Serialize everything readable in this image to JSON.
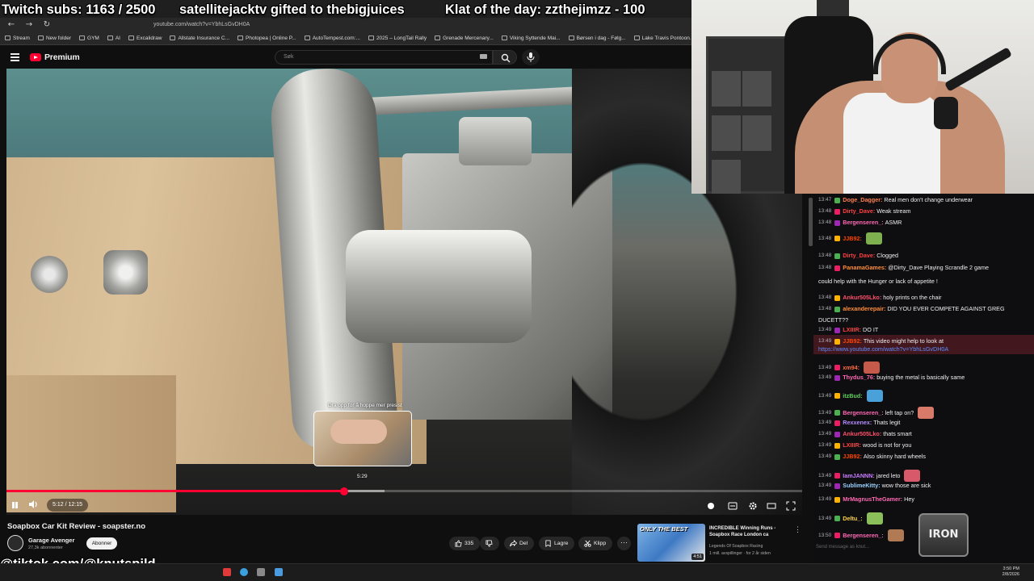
{
  "overlay": {
    "subs": "Twitch subs: 1163 / 2500",
    "gift": "satellitejacktv gifted to thebigjuices",
    "klat": "Klat of the day: zzthejimzz - 100",
    "tiktok": "@tiktok.com/@knutspild"
  },
  "browser": {
    "url": "youtube.com/watch?v=YbhLsGvDH0A",
    "bookmarks": [
      "Stream",
      "New folder",
      "GYM",
      "AI",
      "Excalidraw",
      "Allstate Insurance C...",
      "Photopea | Online P...",
      "AutoTempest.com:...",
      "2025 – LongTail Rally",
      "Grenade Mercenary...",
      "Viking Syttende Mai...",
      "Børsen i dag - Følg...",
      "Lake Travis Pontoon..."
    ]
  },
  "youtube": {
    "logo": "Premium",
    "search_placeholder": "Søk",
    "preview_hint": "Dra opp for å hoppe mer presist",
    "preview_time": "5:29",
    "time": "5:12 / 12:15",
    "progress": 0.4244,
    "loaded": 0.475,
    "title": "Soapbox Car Kit Review - soapster.no",
    "channel": "Garage Avenger",
    "subs": "27,3k abonnenter",
    "subscribe": "Abonner",
    "likes": "335",
    "share": "Del",
    "save": "Lagre",
    "clip": "Klipp",
    "reco": {
      "thumb_text": "ONLY THE BEST",
      "duration": "4:51",
      "title": "INCREDIBLE Winning Runs - Soapbox Race London ca",
      "channel": "Legends Of Soapbox Racing",
      "views": "1 mill. avspillinger · for 2 år siden"
    }
  },
  "chat": {
    "messages": [
      {
        "ts": "13:47",
        "user": "Doge_Dagger:",
        "color": "#ff7f50",
        "text": "Real men don't change underwear"
      },
      {
        "ts": "13:48",
        "user": "Dirty_Dave:",
        "color": "#ff4040",
        "text": "Weak stream"
      },
      {
        "ts": "13:48",
        "user": "Bergenseren_:",
        "color": "#ff69b4",
        "text": "ASMR"
      },
      {
        "ts": "13:48",
        "user": "JJB92:",
        "color": "#ff4500",
        "text": ""
      },
      {
        "ts": "13:48",
        "user": "Dirty_Dave:",
        "color": "#ff4040",
        "text": "Clogged"
      },
      {
        "ts": "13:48",
        "user": "PanamaGames:",
        "color": "#ff8c3a",
        "text": "@Dirty_Dave Playing Scrandle 2 game"
      },
      {
        "ts": "",
        "user": "",
        "color": "#efeff1",
        "text": "could help with the Hunger or lack of appetite !"
      },
      {
        "ts": "13:48",
        "user": "Ankur505Lko:",
        "color": "#ff4f6a",
        "text": "holy prints on the chair"
      },
      {
        "ts": "13:48",
        "user": "alexanderepair:",
        "color": "#ff8c3a",
        "text": "DID YOU EVER COMPETE AGAINST GREG"
      },
      {
        "ts": "",
        "user": "",
        "color": "#efeff1",
        "text": "DUCETT??"
      },
      {
        "ts": "13:49",
        "user": "LXIIIR:",
        "color": "#ff4040",
        "text": "DO IT"
      },
      {
        "ts": "13:49",
        "user": "JJB92:",
        "color": "#ff4500",
        "text": "This video might help to look at"
      },
      {
        "ts": "",
        "user": "",
        "color": "#5c8fff",
        "text": "https://www.youtube.com/watch?v=YbhLsGvDH0A"
      },
      {
        "ts": "13:49",
        "user": "xm94:",
        "color": "#ff6a3d",
        "text": ""
      },
      {
        "ts": "13:49",
        "user": "Thydus_76:",
        "color": "#ff69b4",
        "text": "buying the metal is basically same"
      },
      {
        "ts": "13:49",
        "user": "itzBud:",
        "color": "#5fd35f",
        "text": ""
      },
      {
        "ts": "13:49",
        "user": "Bergenseren_:",
        "color": "#ff69b4",
        "text": "left tap on?"
      },
      {
        "ts": "13:49",
        "user": "Rexxenex:",
        "color": "#b48cff",
        "text": "Thats legit"
      },
      {
        "ts": "13:49",
        "user": "Ankur505Lko:",
        "color": "#ff4f6a",
        "text": "thats smart"
      },
      {
        "ts": "13:49",
        "user": "LXIIIR:",
        "color": "#ff4040",
        "text": "wood is not for you"
      },
      {
        "ts": "13:49",
        "user": "JJB92:",
        "color": "#ff4500",
        "text": "Also skinny hard wheels"
      },
      {
        "ts": "13:49",
        "user": "IamJANNN:",
        "color": "#c87dff",
        "text": "jared leto"
      },
      {
        "ts": "13:49",
        "user": "SublimeKitty:",
        "color": "#9ad0ff",
        "text": "wow those are sick"
      },
      {
        "ts": "13:49",
        "user": "MrMagnusTheGamer:",
        "color": "#ff69b4",
        "text": "Hey"
      },
      {
        "ts": "13:49",
        "user": "Deltu_:",
        "color": "#ffd23f",
        "text": ""
      },
      {
        "ts": "13:50",
        "user": "Bergenseren_:",
        "color": "#ff69b4",
        "text": ""
      }
    ],
    "input_placeholder": "Send message as knut...",
    "logo": "IRON"
  },
  "taskbar": {
    "time": "3:50 PM",
    "date": "2/8/2026"
  },
  "colors": {
    "accent": "#ff0033",
    "chat_bg": "#0e0e10",
    "link": "#5c8fff"
  }
}
